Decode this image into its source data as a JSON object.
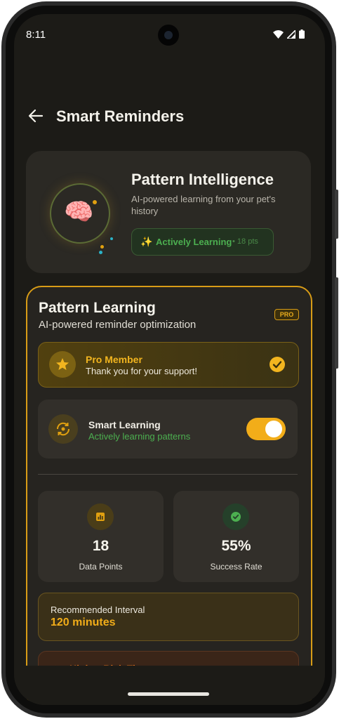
{
  "status": {
    "time": "8:11",
    "icons": [
      "wifi-icon",
      "signal-icon",
      "battery-icon"
    ]
  },
  "appbar": {
    "title": "Smart Reminders",
    "back_icon": "arrow-left-icon"
  },
  "hero": {
    "icon": "brain-icon",
    "title": "Pattern Intelligence",
    "subtitle": "AI-powered learning from your pet's history",
    "status_label": "Actively Learning",
    "status_points": "• 18 pts"
  },
  "card": {
    "title": "Pattern Learning",
    "subtitle": "AI-powered reminder optimization",
    "badge": "PRO",
    "pro_member": {
      "title": "Pro Member",
      "subtitle": "Thank you for your support!"
    },
    "smart_learning": {
      "title": "Smart Learning",
      "subtitle": "Actively learning patterns",
      "enabled": true
    },
    "stats": [
      {
        "value": "18",
        "label": "Data Points",
        "icon": "chart-icon"
      },
      {
        "value": "55%",
        "label": "Success Rate",
        "icon": "check-circle-icon"
      }
    ],
    "interval": {
      "label": "Recommended Interval",
      "value": "120 minutes"
    },
    "risk": {
      "title": "Higher Risk Times"
    }
  },
  "colors": {
    "accent": "#f2ad19",
    "green": "#4caf50",
    "background": "#1c1b17",
    "orange": "#e0701c"
  }
}
